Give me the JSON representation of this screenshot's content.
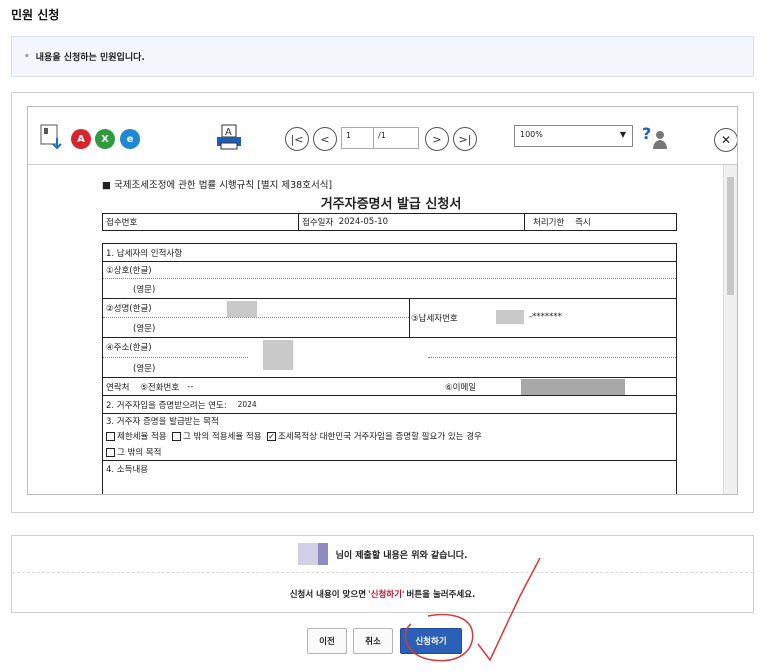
{
  "page_title": "민원 신청",
  "notice": {
    "bullet": "•",
    "text": "내용을 신청하는 민원입니다."
  },
  "viewer": {
    "page_current": "1",
    "page_total": "/1",
    "zoom": "100%",
    "nav_first": "|<",
    "nav_prev": "<",
    "nav_next": ">",
    "nav_last": ">|",
    "close": "✕"
  },
  "doc": {
    "law_ref": "■ 국제조세조정에 관한 법률 시행규칙 [별지 제38호서식]",
    "title": "거주자증명서 발급 신청서",
    "receipt_no_label": "접수번호",
    "receipt_date_label": "접수일자",
    "receipt_date": "2024-05-10",
    "process_label": "처리기한",
    "process_value": "즉시",
    "sec1_title": "1. 납세자의 인적사항",
    "company_kr": "①상호(한글)",
    "company_en": "(영문)",
    "name_kr": "②성명(한글)",
    "name_en": "(영문)",
    "tax_no_label": "③납세자번호",
    "tax_no_value": "-*******",
    "addr_kr": "④주소(한글)",
    "addr_en": "(영문)",
    "contact": "연락처",
    "phone_label": "⑤전화번호",
    "phone_value": "--",
    "email_label": "⑥이메일",
    "sec2": "2. 거주자임을 증명받으려는 연도:",
    "sec2_year": "2024",
    "sec3": "3. 거주자 증명을 발급받는 목적",
    "purpose1": "제한세율 적용",
    "purpose2": "그 밖의 적용세율 적용",
    "purpose3_check": "✓",
    "purpose3": "조세목적상 대한민국 거주자임을 증명할 필요가 있는 경우",
    "purpose4": "그 밖의 목적",
    "sec4": "4. 소득내용"
  },
  "confirm": {
    "statement": "님이 제출할 내용은 위와 같습니다.",
    "instr_before": "신청서 내용이 맞으면",
    "instr_highlight": "'신청하기'",
    "instr_after": "버튼을 눌러주세요."
  },
  "buttons": {
    "prev": "이전",
    "cancel": "취소",
    "submit": "신청하기"
  },
  "colors": {
    "primary": "#2b5fb8",
    "highlight": "#c8102e",
    "annotation": "#d63a3a"
  },
  "icons": [
    "save-icon",
    "pdf-icon",
    "excel-icon",
    "hwp-icon",
    "print-icon",
    "help-icon"
  ]
}
